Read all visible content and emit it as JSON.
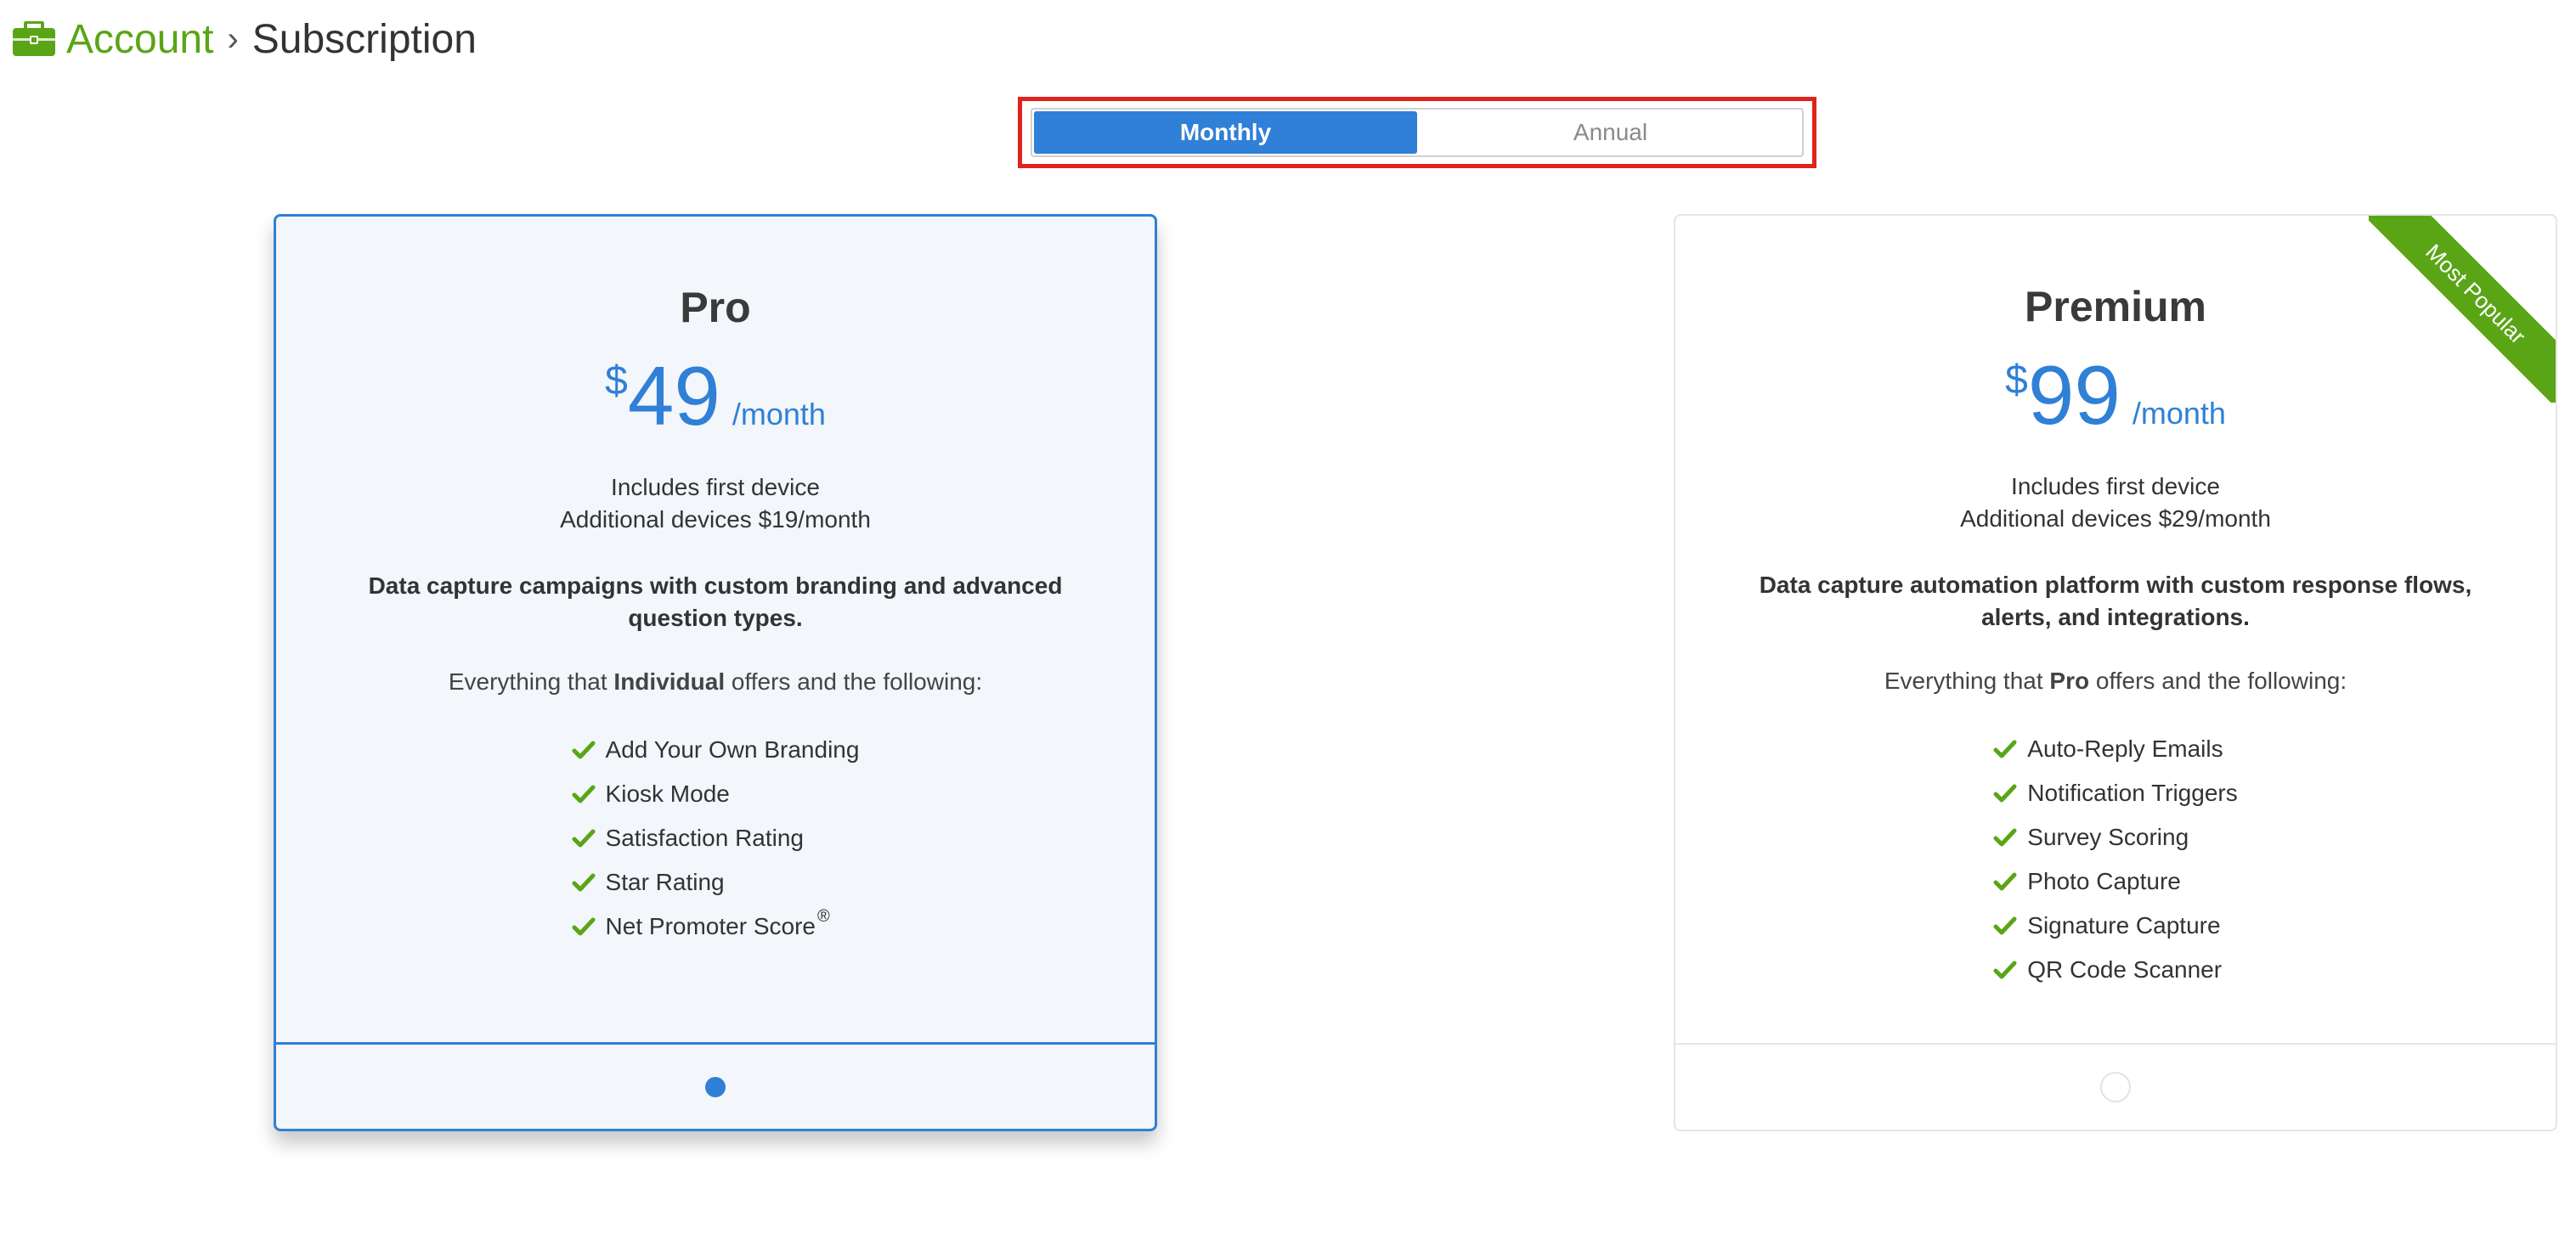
{
  "breadcrumb": {
    "account": "Account",
    "separator": "›",
    "current": "Subscription"
  },
  "billing_toggle": {
    "monthly": "Monthly",
    "annual": "Annual",
    "selected": "Monthly"
  },
  "plans": [
    {
      "name": "Pro",
      "currency": "$",
      "price": "49",
      "period": "/month",
      "device_line_1": "Includes first device",
      "device_line_2": "Additional devices $19/month",
      "description": "Data capture campaigns with custom branding and advanced question types.",
      "everything_prefix": "Everything that ",
      "everything_plan": "Individual",
      "everything_suffix": " offers and the following:",
      "features": [
        "Add Your Own Branding",
        "Kiosk Mode",
        "Satisfaction Rating",
        "Star Rating",
        "Net Promoter Score"
      ],
      "feature_superscript": "®",
      "selected": true
    },
    {
      "name": "Premium",
      "currency": "$",
      "price": "99",
      "period": "/month",
      "device_line_1": "Includes first device",
      "device_line_2": "Additional devices $29/month",
      "description": "Data capture automation platform with custom response flows, alerts, and integrations.",
      "everything_prefix": "Everything that ",
      "everything_plan": "Pro",
      "everything_suffix": " offers and the following:",
      "features": [
        "Auto-Reply Emails",
        "Notification Triggers",
        "Survey Scoring",
        "Photo Capture",
        "Signature Capture",
        "QR Code Scanner"
      ],
      "ribbon": "Most Popular",
      "selected": false
    }
  ],
  "colors": {
    "accent_blue": "#2f80d6",
    "brand_green": "#5aa516",
    "highlight_red": "#e0231b"
  },
  "icons": {
    "breadcrumb": "briefcase-icon",
    "feature": "checkmark-icon"
  }
}
